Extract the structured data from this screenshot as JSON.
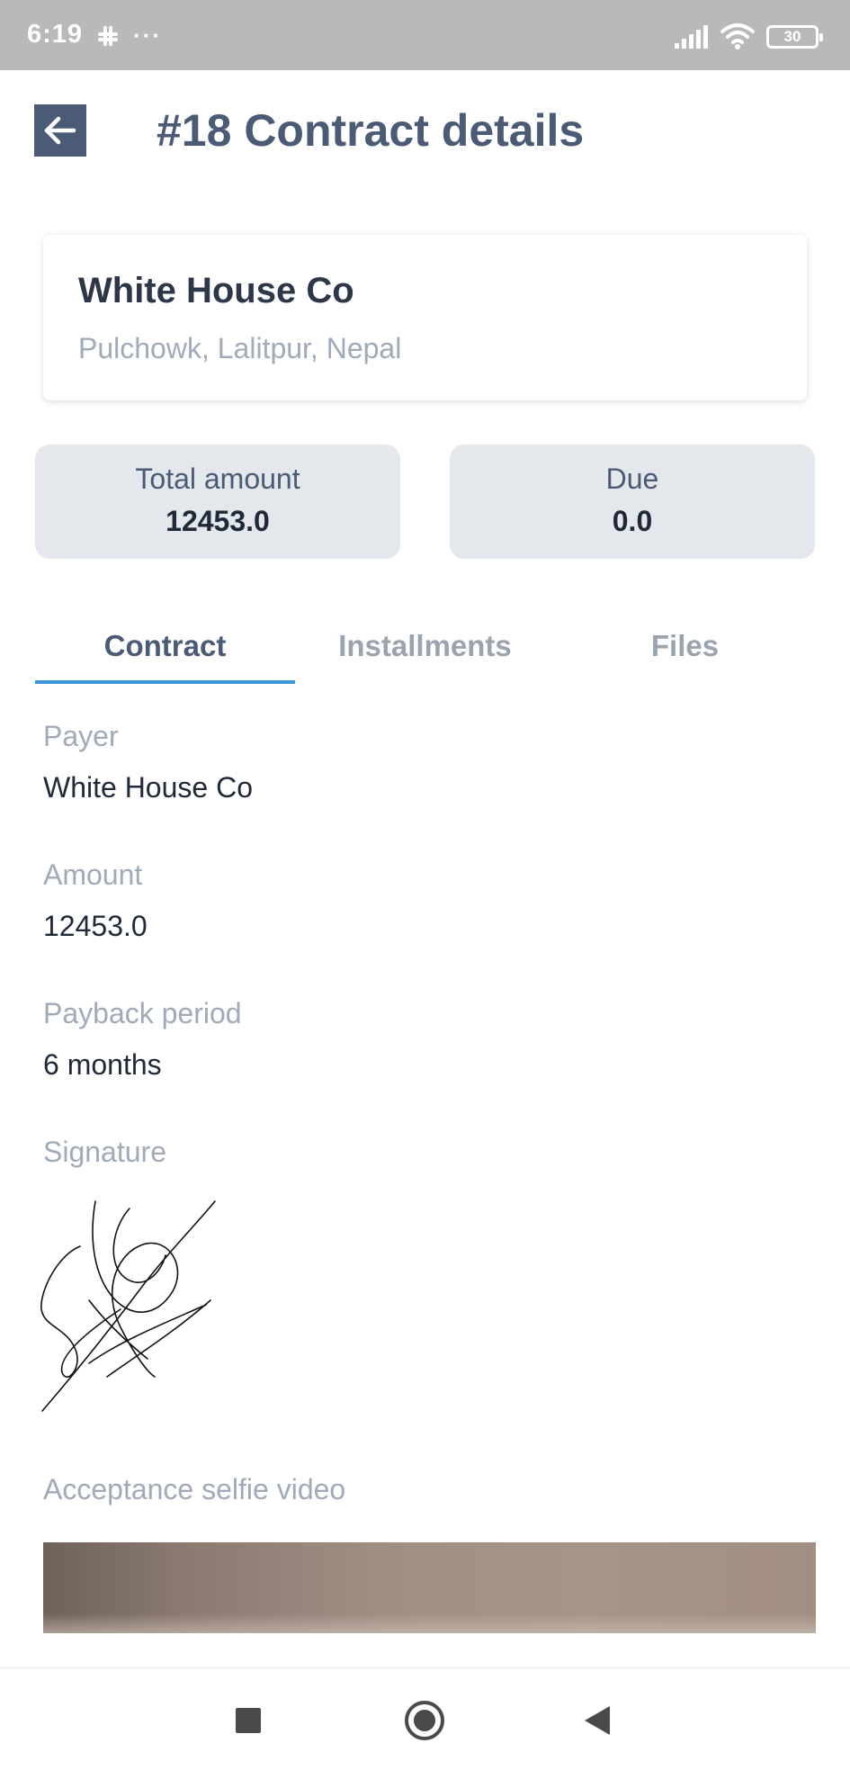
{
  "status_bar": {
    "time": "6:19",
    "notification_icons": [
      "slack-icon",
      "more-dots-icon"
    ],
    "dots": "···",
    "battery": "30"
  },
  "header": {
    "title": "#18 Contract details",
    "back_icon": "arrow-left-icon",
    "accent_color": "#4b5a75"
  },
  "company": {
    "name": "White House Co",
    "address": "Pulchowk, Lalitpur, Nepal"
  },
  "summary": {
    "total_label": "Total amount",
    "total_value": "12453.0",
    "due_label": "Due",
    "due_value": "0.0"
  },
  "tabs": {
    "items": [
      {
        "label": "Contract",
        "active": true
      },
      {
        "label": "Installments",
        "active": false
      },
      {
        "label": "Files",
        "active": false
      }
    ],
    "active_color": "#3b95d8"
  },
  "contract": {
    "payer_label": "Payer",
    "payer_value": "White House Co",
    "amount_label": "Amount",
    "amount_value": "12453.0",
    "period_label": "Payback period",
    "period_value": "6 months",
    "signature_label": "Signature",
    "video_label": "Acceptance selfie video"
  },
  "nav_bar": {
    "icons": [
      "recents-square-icon",
      "home-circle-icon",
      "back-triangle-icon"
    ]
  }
}
